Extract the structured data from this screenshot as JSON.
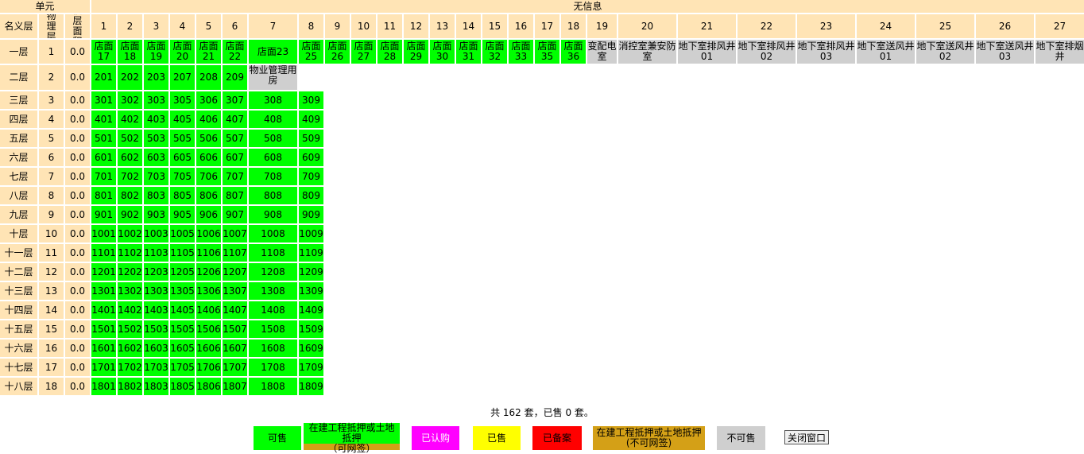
{
  "header": {
    "unit_label": "单元",
    "no_info": "无信息",
    "nominal_floor": "名义层",
    "physical_floor": "物理层",
    "floor_area": "楼层面积",
    "columns": [
      "1",
      "2",
      "3",
      "4",
      "5",
      "6",
      "7",
      "8",
      "9",
      "10",
      "11",
      "12",
      "13",
      "14",
      "15",
      "16",
      "17",
      "18",
      "19",
      "20",
      "21",
      "22",
      "23",
      "24",
      "25",
      "26",
      "27"
    ]
  },
  "floors": [
    {
      "name": "一层",
      "physical": "1",
      "area": "0.0",
      "units": [
        {
          "label": "店面17",
          "status": "green"
        },
        {
          "label": "店面18",
          "status": "green"
        },
        {
          "label": "店面19",
          "status": "green"
        },
        {
          "label": "店面20",
          "status": "green"
        },
        {
          "label": "店面21",
          "status": "green"
        },
        {
          "label": "店面22",
          "status": "green"
        },
        {
          "label": "店面23",
          "status": "green"
        },
        {
          "label": "店面25",
          "status": "green"
        },
        {
          "label": "店面26",
          "status": "green"
        },
        {
          "label": "店面27",
          "status": "green"
        },
        {
          "label": "店面28",
          "status": "green"
        },
        {
          "label": "店面29",
          "status": "green"
        },
        {
          "label": "店面30",
          "status": "green"
        },
        {
          "label": "店面31",
          "status": "green"
        },
        {
          "label": "店面32",
          "status": "green"
        },
        {
          "label": "店面33",
          "status": "green"
        },
        {
          "label": "店面35",
          "status": "green"
        },
        {
          "label": "店面36",
          "status": "green"
        },
        {
          "label": "变配电室",
          "status": "gray"
        },
        {
          "label": "消控室兼安防室",
          "status": "gray"
        },
        {
          "label": "地下室排风井01",
          "status": "gray"
        },
        {
          "label": "地下室排风井02",
          "status": "gray"
        },
        {
          "label": "地下室排风井03",
          "status": "gray"
        },
        {
          "label": "地下室送风井01",
          "status": "gray"
        },
        {
          "label": "地下室送风井02",
          "status": "gray"
        },
        {
          "label": "地下室送风井03",
          "status": "gray"
        },
        {
          "label": "地下室排烟井",
          "status": "gray"
        }
      ]
    },
    {
      "name": "二层",
      "physical": "2",
      "area": "0.0",
      "units": [
        {
          "label": "201",
          "status": "green"
        },
        {
          "label": "202",
          "status": "green"
        },
        {
          "label": "203",
          "status": "green"
        },
        {
          "label": "207",
          "status": "green"
        },
        {
          "label": "208",
          "status": "green"
        },
        {
          "label": "209",
          "status": "green"
        },
        {
          "label": "物业管理用房",
          "status": "gray"
        }
      ]
    },
    {
      "name": "三层",
      "physical": "3",
      "area": "0.0",
      "units": [
        {
          "label": "301",
          "status": "green"
        },
        {
          "label": "302",
          "status": "green"
        },
        {
          "label": "303",
          "status": "green"
        },
        {
          "label": "305",
          "status": "green"
        },
        {
          "label": "306",
          "status": "green"
        },
        {
          "label": "307",
          "status": "green"
        },
        {
          "label": "308",
          "status": "green"
        },
        {
          "label": "309",
          "status": "green"
        }
      ]
    },
    {
      "name": "四层",
      "physical": "4",
      "area": "0.0",
      "units": [
        {
          "label": "401",
          "status": "green"
        },
        {
          "label": "402",
          "status": "green"
        },
        {
          "label": "403",
          "status": "green"
        },
        {
          "label": "405",
          "status": "green"
        },
        {
          "label": "406",
          "status": "green"
        },
        {
          "label": "407",
          "status": "green"
        },
        {
          "label": "408",
          "status": "green"
        },
        {
          "label": "409",
          "status": "green"
        }
      ]
    },
    {
      "name": "五层",
      "physical": "5",
      "area": "0.0",
      "units": [
        {
          "label": "501",
          "status": "green"
        },
        {
          "label": "502",
          "status": "green"
        },
        {
          "label": "503",
          "status": "green"
        },
        {
          "label": "505",
          "status": "green"
        },
        {
          "label": "506",
          "status": "green"
        },
        {
          "label": "507",
          "status": "green"
        },
        {
          "label": "508",
          "status": "green"
        },
        {
          "label": "509",
          "status": "green"
        }
      ]
    },
    {
      "name": "六层",
      "physical": "6",
      "area": "0.0",
      "units": [
        {
          "label": "601",
          "status": "green"
        },
        {
          "label": "602",
          "status": "green"
        },
        {
          "label": "603",
          "status": "green"
        },
        {
          "label": "605",
          "status": "green"
        },
        {
          "label": "606",
          "status": "green"
        },
        {
          "label": "607",
          "status": "green"
        },
        {
          "label": "608",
          "status": "green"
        },
        {
          "label": "609",
          "status": "green"
        }
      ]
    },
    {
      "name": "七层",
      "physical": "7",
      "area": "0.0",
      "units": [
        {
          "label": "701",
          "status": "green"
        },
        {
          "label": "702",
          "status": "green"
        },
        {
          "label": "703",
          "status": "green"
        },
        {
          "label": "705",
          "status": "green"
        },
        {
          "label": "706",
          "status": "green"
        },
        {
          "label": "707",
          "status": "green"
        },
        {
          "label": "708",
          "status": "green"
        },
        {
          "label": "709",
          "status": "green"
        }
      ]
    },
    {
      "name": "八层",
      "physical": "8",
      "area": "0.0",
      "units": [
        {
          "label": "801",
          "status": "green"
        },
        {
          "label": "802",
          "status": "green"
        },
        {
          "label": "803",
          "status": "green"
        },
        {
          "label": "805",
          "status": "green"
        },
        {
          "label": "806",
          "status": "green"
        },
        {
          "label": "807",
          "status": "green"
        },
        {
          "label": "808",
          "status": "green"
        },
        {
          "label": "809",
          "status": "green"
        }
      ]
    },
    {
      "name": "九层",
      "physical": "9",
      "area": "0.0",
      "units": [
        {
          "label": "901",
          "status": "green"
        },
        {
          "label": "902",
          "status": "green"
        },
        {
          "label": "903",
          "status": "green"
        },
        {
          "label": "905",
          "status": "green"
        },
        {
          "label": "906",
          "status": "green"
        },
        {
          "label": "907",
          "status": "green"
        },
        {
          "label": "908",
          "status": "green"
        },
        {
          "label": "909",
          "status": "green"
        }
      ]
    },
    {
      "name": "十层",
      "physical": "10",
      "area": "0.0",
      "units": [
        {
          "label": "1001",
          "status": "green"
        },
        {
          "label": "1002",
          "status": "green"
        },
        {
          "label": "1003",
          "status": "green"
        },
        {
          "label": "1005",
          "status": "green"
        },
        {
          "label": "1006",
          "status": "green"
        },
        {
          "label": "1007",
          "status": "green"
        },
        {
          "label": "1008",
          "status": "green"
        },
        {
          "label": "1009",
          "status": "green"
        }
      ]
    },
    {
      "name": "十一层",
      "physical": "11",
      "area": "0.0",
      "units": [
        {
          "label": "1101",
          "status": "green"
        },
        {
          "label": "1102",
          "status": "green"
        },
        {
          "label": "1103",
          "status": "green"
        },
        {
          "label": "1105",
          "status": "green"
        },
        {
          "label": "1106",
          "status": "green"
        },
        {
          "label": "1107",
          "status": "green"
        },
        {
          "label": "1108",
          "status": "green"
        },
        {
          "label": "1109",
          "status": "green"
        }
      ]
    },
    {
      "name": "十二层",
      "physical": "12",
      "area": "0.0",
      "units": [
        {
          "label": "1201",
          "status": "green"
        },
        {
          "label": "1202",
          "status": "green"
        },
        {
          "label": "1203",
          "status": "green"
        },
        {
          "label": "1205",
          "status": "green"
        },
        {
          "label": "1206",
          "status": "green"
        },
        {
          "label": "1207",
          "status": "green"
        },
        {
          "label": "1208",
          "status": "green"
        },
        {
          "label": "1209",
          "status": "green"
        }
      ]
    },
    {
      "name": "十三层",
      "physical": "13",
      "area": "0.0",
      "units": [
        {
          "label": "1301",
          "status": "green"
        },
        {
          "label": "1302",
          "status": "green"
        },
        {
          "label": "1303",
          "status": "green"
        },
        {
          "label": "1305",
          "status": "green"
        },
        {
          "label": "1306",
          "status": "green"
        },
        {
          "label": "1307",
          "status": "green"
        },
        {
          "label": "1308",
          "status": "green"
        },
        {
          "label": "1309",
          "status": "green"
        }
      ]
    },
    {
      "name": "十四层",
      "physical": "14",
      "area": "0.0",
      "units": [
        {
          "label": "1401",
          "status": "green"
        },
        {
          "label": "1402",
          "status": "green"
        },
        {
          "label": "1403",
          "status": "green"
        },
        {
          "label": "1405",
          "status": "green"
        },
        {
          "label": "1406",
          "status": "green"
        },
        {
          "label": "1407",
          "status": "green"
        },
        {
          "label": "1408",
          "status": "green"
        },
        {
          "label": "1409",
          "status": "green"
        }
      ]
    },
    {
      "name": "十五层",
      "physical": "15",
      "area": "0.0",
      "units": [
        {
          "label": "1501",
          "status": "green"
        },
        {
          "label": "1502",
          "status": "green"
        },
        {
          "label": "1503",
          "status": "green"
        },
        {
          "label": "1505",
          "status": "green"
        },
        {
          "label": "1506",
          "status": "green"
        },
        {
          "label": "1507",
          "status": "green"
        },
        {
          "label": "1508",
          "status": "green"
        },
        {
          "label": "1509",
          "status": "green"
        }
      ]
    },
    {
      "name": "十六层",
      "physical": "16",
      "area": "0.0",
      "units": [
        {
          "label": "1601",
          "status": "green"
        },
        {
          "label": "1602",
          "status": "green"
        },
        {
          "label": "1603",
          "status": "green"
        },
        {
          "label": "1605",
          "status": "green"
        },
        {
          "label": "1606",
          "status": "green"
        },
        {
          "label": "1607",
          "status": "green"
        },
        {
          "label": "1608",
          "status": "green"
        },
        {
          "label": "1609",
          "status": "green"
        }
      ]
    },
    {
      "name": "十七层",
      "physical": "17",
      "area": "0.0",
      "units": [
        {
          "label": "1701",
          "status": "green"
        },
        {
          "label": "1702",
          "status": "green"
        },
        {
          "label": "1703",
          "status": "green"
        },
        {
          "label": "1705",
          "status": "green"
        },
        {
          "label": "1706",
          "status": "green"
        },
        {
          "label": "1707",
          "status": "green"
        },
        {
          "label": "1708",
          "status": "green"
        },
        {
          "label": "1709",
          "status": "green"
        }
      ]
    },
    {
      "name": "十八层",
      "physical": "18",
      "area": "0.0",
      "units": [
        {
          "label": "1801",
          "status": "green"
        },
        {
          "label": "1802",
          "status": "green"
        },
        {
          "label": "1803",
          "status": "green"
        },
        {
          "label": "1805",
          "status": "green"
        },
        {
          "label": "1806",
          "status": "green"
        },
        {
          "label": "1807",
          "status": "green"
        },
        {
          "label": "1808",
          "status": "green"
        },
        {
          "label": "1809",
          "status": "green"
        }
      ]
    }
  ],
  "summary": "共 162 套，已售 0 套。",
  "legend": [
    {
      "label": "可售",
      "color": "#00ff00",
      "text_color": "#000000"
    },
    {
      "label": "在建工程抵押或土地抵押",
      "sub": "（可网签）",
      "color": "#d4a017",
      "top_color": "#00ff00",
      "text_color": "#000000"
    },
    {
      "label": "已认购",
      "color": "#ff00ff",
      "text_color": "#ffffff"
    },
    {
      "label": "已售",
      "color": "#ffff00",
      "text_color": "#000000"
    },
    {
      "label": "已备案",
      "color": "#ff0000",
      "text_color": "#000000"
    },
    {
      "label": "在建工程抵押或土地抵押",
      "sub": "(不可网签)",
      "color": "#d4a017",
      "text_color": "#000000"
    },
    {
      "label": "不可售",
      "color": "#cfcfcf",
      "text_color": "#000000"
    }
  ],
  "close_button": "关闭窗口",
  "colors": {
    "header": "#ffe4b5",
    "available": "#00ff00",
    "unavailable": "#cfcfcf"
  }
}
